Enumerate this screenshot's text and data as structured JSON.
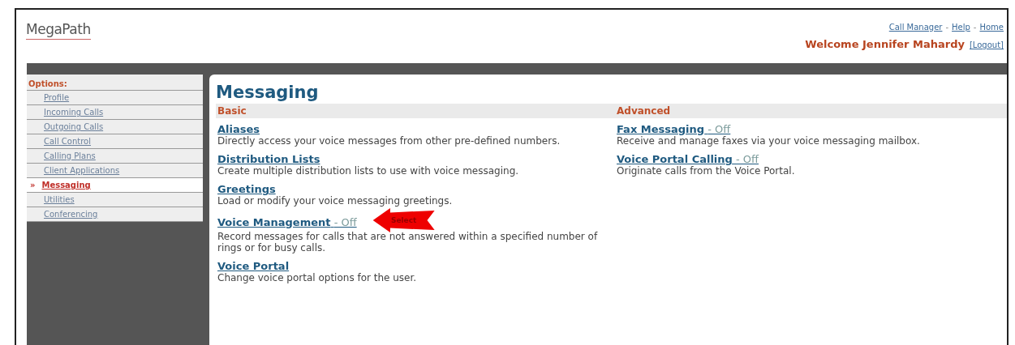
{
  "logo": {
    "text": "MegaPath"
  },
  "top_links": [
    "Call Manager",
    "Help",
    "Home"
  ],
  "link_separator": "-",
  "welcome": {
    "text": "Welcome Jennifer Mahardy",
    "logout": "[Logout]"
  },
  "sidebar": {
    "heading": "Options:",
    "marker": "»",
    "items": [
      {
        "label": "Profile",
        "selected": false
      },
      {
        "label": "Incoming Calls",
        "selected": false
      },
      {
        "label": "Outgoing Calls",
        "selected": false
      },
      {
        "label": "Call Control",
        "selected": false
      },
      {
        "label": "Calling Plans",
        "selected": false
      },
      {
        "label": "Client Applications",
        "selected": false
      },
      {
        "label": "Messaging",
        "selected": true
      },
      {
        "label": "Utilities",
        "selected": false
      },
      {
        "label": "Conferencing",
        "selected": false
      }
    ]
  },
  "page_title": "Messaging",
  "sections": [
    {
      "heading": "Basic",
      "items": [
        {
          "title": "Aliases",
          "description": "Directly access your voice messages from other pre-defined numbers."
        },
        {
          "title": "Distribution Lists",
          "description": "Create multiple distribution lists to use with voice messaging."
        },
        {
          "title": "Greetings",
          "description": "Load or modify your voice messaging greetings."
        },
        {
          "title": "Voice Management",
          "status": "- Off",
          "description": "Record messages for calls that are not answered within a specified number of rings or for busy calls.",
          "callout": "Select"
        },
        {
          "title": "Voice Portal",
          "description": "Change voice portal options for the user."
        }
      ]
    },
    {
      "heading": "Advanced",
      "items": [
        {
          "title": "Fax Messaging",
          "status": "- Off",
          "description": "Receive and manage faxes via your voice messaging mailbox."
        },
        {
          "title": "Voice Portal Calling",
          "status": "- Off",
          "description": "Originate calls from the Voice Portal."
        }
      ]
    }
  ]
}
